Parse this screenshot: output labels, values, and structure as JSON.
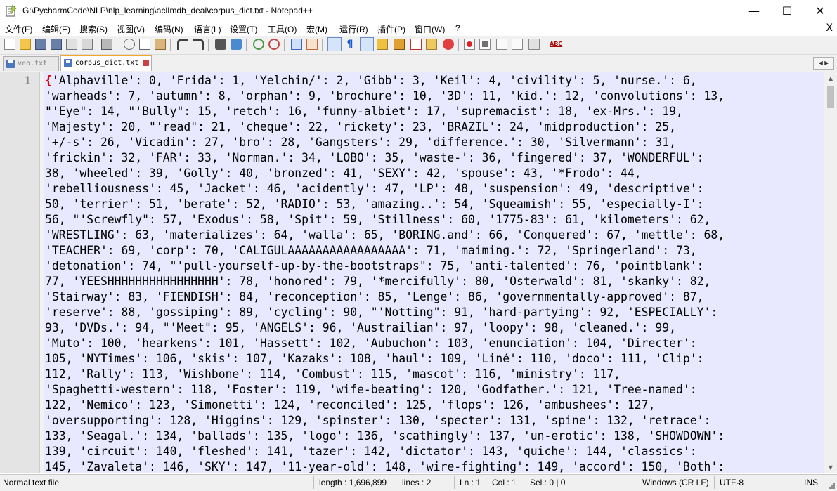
{
  "window": {
    "title": "G:\\PycharmCode\\NLP\\nlp_learning\\aclImdb_deal\\corpus_dict.txt - Notepad++",
    "minimize_label": "—",
    "maximize_label": "☐",
    "close_label": "✕"
  },
  "menu": {
    "items": [
      "文件(F)",
      "编辑(E)",
      "搜索(S)",
      "视图(V)",
      "编码(N)",
      "语言(L)",
      "设置(T)",
      "工具(O)",
      "宏(M)",
      "运行(R)",
      "插件(P)",
      "窗口(W)",
      "?"
    ],
    "close_label": "X"
  },
  "toolbar": {
    "icons": [
      "new-file-icon",
      "open-file-icon",
      "save-icon",
      "save-all-icon",
      "close-icon",
      "close-all-icon",
      "print-icon",
      "cut-icon",
      "copy-icon",
      "paste-icon",
      "undo-icon",
      "redo-icon",
      "find-icon",
      "replace-icon",
      "zoom-in-icon",
      "zoom-out-icon",
      "sync-vertical-icon",
      "sync-horizontal-icon",
      "word-wrap-icon",
      "show-all-chars-icon",
      "indent-guide-icon",
      "user-language-icon",
      "doc-map-icon",
      "function-list-icon",
      "folder-workspace-icon",
      "monitoring-icon",
      "record-macro-icon",
      "stop-record-icon",
      "play-macro-icon",
      "run-macro-multiple-icon",
      "save-macro-icon",
      "spell-check-icon"
    ]
  },
  "tabs": [
    {
      "label": "veo.txt",
      "active": false
    },
    {
      "label": "corpus_dict.txt",
      "active": true
    }
  ],
  "editor": {
    "line_numbers": [
      "1"
    ],
    "lines": [
      "{'Alphaville': 0, 'Frida': 1, 'Yelchin/': 2, 'Gibb': 3, 'Keil': 4, 'civility': 5, 'nurse.': 6,",
      "'warheads': 7, 'autumn': 8, 'orphan': 9, 'brochure': 10, '3D': 11, 'kid.': 12, 'convolutions': 13,",
      "\"'Eye\": 14, \"'Bully\": 15, 'retch': 16, 'funny-albiet': 17, 'supremacist': 18, 'ex-Mrs.': 19,",
      "'Majesty': 20, \"'read\": 21, 'cheque': 22, 'rickety': 23, 'BRAZIL': 24, 'midproduction': 25,",
      "'+/-s': 26, 'Vicadin': 27, 'bro': 28, 'Gangsters': 29, 'difference.': 30, 'Silvermann': 31,",
      "'frickin': 32, 'FAR': 33, 'Norman.': 34, 'LOBO': 35, 'waste-': 36, 'fingered': 37, 'WONDERFUL':",
      "38, 'wheeled': 39, 'Golly': 40, 'bronzed': 41, 'SEXY': 42, 'spouse': 43, '*Frodo': 44,",
      "'rebelliousness': 45, 'Jacket': 46, 'acidently': 47, 'LP': 48, 'suspension': 49, 'descriptive':",
      "50, 'terrier': 51, 'berate': 52, 'RADIO': 53, 'amazing..': 54, 'Squeamish': 55, 'especially-I':",
      "56, \"'Screwfly\": 57, 'Exodus': 58, 'Spit': 59, 'Stillness': 60, '1775-83': 61, 'kilometers': 62,",
      "'WRESTLING': 63, 'materializes': 64, 'walla': 65, 'BORING.and': 66, 'Conquered': 67, 'mettle': 68,",
      "'TEACHER': 69, 'corp': 70, 'CALIGULAAAAAAAAAAAAAAAAA': 71, 'maiming.': 72, 'Springerland': 73,",
      "'detonation': 74, \"'pull-yourself-up-by-the-bootstraps\": 75, 'anti-talented': 76, 'pointblank':",
      "77, 'YEESHHHHHHHHHHHHHHHH': 78, 'honored': 79, '*mercifully': 80, 'Osterwald': 81, 'skanky': 82,",
      "'Stairway': 83, 'FIENDISH': 84, 'reconception': 85, 'Lenge': 86, 'governmentally-approved': 87,",
      "'reserve': 88, 'gossiping': 89, 'cycling': 90, \"'Notting\": 91, 'hard-partying': 92, 'ESPECIALLY':",
      "93, 'DVDs.': 94, \"'Meet\": 95, 'ANGELS': 96, 'Austrailian': 97, 'loopy': 98, 'cleaned.': 99,",
      "'Muto': 100, 'hearkens': 101, 'Hassett': 102, 'Aubuchon': 103, 'enunciation': 104, 'Directer':",
      "105, 'NYTimes': 106, 'skis': 107, 'Kazaks': 108, 'haul': 109, 'Liné': 110, 'doco': 111, 'Clip':",
      "112, 'Rally': 113, 'Wishbone': 114, 'Combust': 115, 'mascot': 116, 'ministry': 117,",
      "'Spaghetti-western': 118, 'Foster': 119, 'wife-beating': 120, 'Godfather.': 121, 'Tree-named':",
      "122, 'Nemico': 123, 'Simonetti': 124, 'reconciled': 125, 'flops': 126, 'ambushees': 127,",
      "'oversupporting': 128, 'Higgins': 129, 'spinster': 130, 'specter': 131, 'spine': 132, 'retrace':",
      "133, 'Seagal.': 134, 'ballads': 135, 'logo': 136, 'scathingly': 137, 'un-erotic': 138, 'SHOWDOWN':",
      "139, 'circuit': 140, 'fleshed': 141, 'tazer': 142, 'dictator': 143, 'quiche': 144, 'classics':",
      "145, 'Zavaleta': 146, 'SKY': 147, '11-year-old': 148, 'wire-fighting': 149, 'accord': 150, 'Both':"
    ]
  },
  "statusbar": {
    "file_type": "Normal text file",
    "length": "length : 1,696,899",
    "lines": "lines : 2",
    "ln": "Ln : 1",
    "col": "Col : 1",
    "sel": "Sel : 0 | 0",
    "eol": "Windows (CR LF)",
    "encoding": "UTF-8",
    "mode": "INS"
  },
  "colors": {
    "editor_bg": "#e8e8ff",
    "brace": "#e00000",
    "active_tab_accent": "#f5a623"
  }
}
